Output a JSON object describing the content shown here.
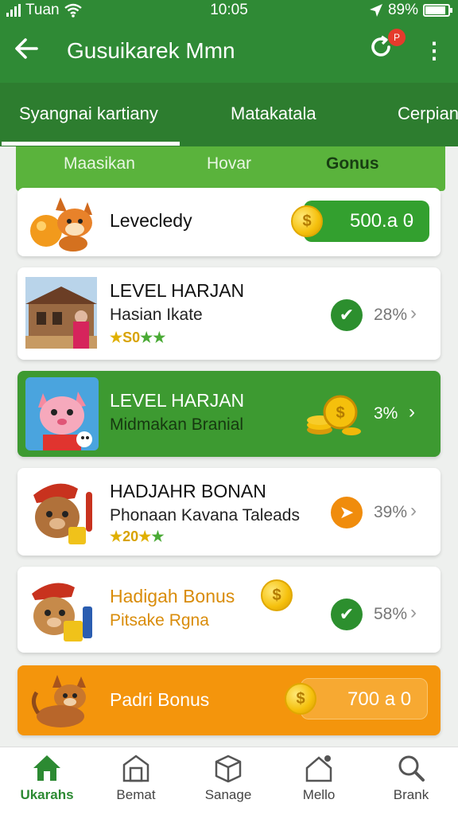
{
  "status_bar": {
    "carrier": "Tuan",
    "time": "10:05",
    "battery": "89%",
    "battery_level": 0.89,
    "icons": [
      "signal-icon",
      "wifi-icon",
      "location-arrow-icon",
      "battery-icon"
    ]
  },
  "app_bar": {
    "back_icon": "arrow-left-icon",
    "title": "Gusuikarek Mmn",
    "refresh_icon": "refresh-icon",
    "notification_count": "P",
    "more_icon": "more-vertical-icon"
  },
  "tabs": [
    "Syangnai kartiany",
    "Matakatala",
    "Cerpian"
  ],
  "subtabs": [
    "Maasikan",
    "Hovar",
    "Gonus"
  ],
  "cards": [
    {
      "title": "Levecledy",
      "pill_value": "500.a  0",
      "pill_arrow": "-",
      "icon": "coin-icon",
      "thumb": "fox-mascot-icon"
    },
    {
      "title": "LEVEL HARJAN",
      "subtitle": "Hasian Ikate",
      "rating": "S0",
      "percent": "28%",
      "chevron": "›",
      "icon": "check-circle-icon",
      "thumb": "house-photo-icon"
    },
    {
      "title": "LEVEL HARJAN",
      "subtitle": "Midmakan Branial",
      "percent": "3%",
      "chevron": "›",
      "icon": "coin-stack-icon",
      "thumb": "pink-cat-mascot-icon"
    },
    {
      "title": "HADJAHR BONAN",
      "subtitle": "Phonaan Kavana Taleads",
      "rating": "20",
      "percent": "39%",
      "chevron": "›",
      "icon": "orange-arrow-circle-icon",
      "thumb": "bear-mascot-icon"
    },
    {
      "title": "Hadigah Bonus",
      "subtitle": "Pitsake Rgna",
      "percent": "58%",
      "chevron": "›",
      "icon": "check-circle-icon",
      "thumb": "bear-gift-mascot-icon"
    },
    {
      "title": "Padri Bonus",
      "pill_value": "700 a  0",
      "icon": "coin-icon",
      "thumb": "cat-mascot-icon"
    }
  ],
  "bottom_nav": [
    {
      "label": "Ukarahs",
      "icon": "home-icon"
    },
    {
      "label": "Bemat",
      "icon": "shop-icon"
    },
    {
      "label": "Sanage",
      "icon": "box-icon"
    },
    {
      "label": "Mello",
      "icon": "house-notification-icon"
    },
    {
      "label": "Brank",
      "icon": "search-icon"
    }
  ],
  "colors": {
    "primary": "#2f8a35",
    "card_green": "#3d9a31",
    "card_orange": "#f4950c",
    "accent_gold": "#f5c00c"
  }
}
